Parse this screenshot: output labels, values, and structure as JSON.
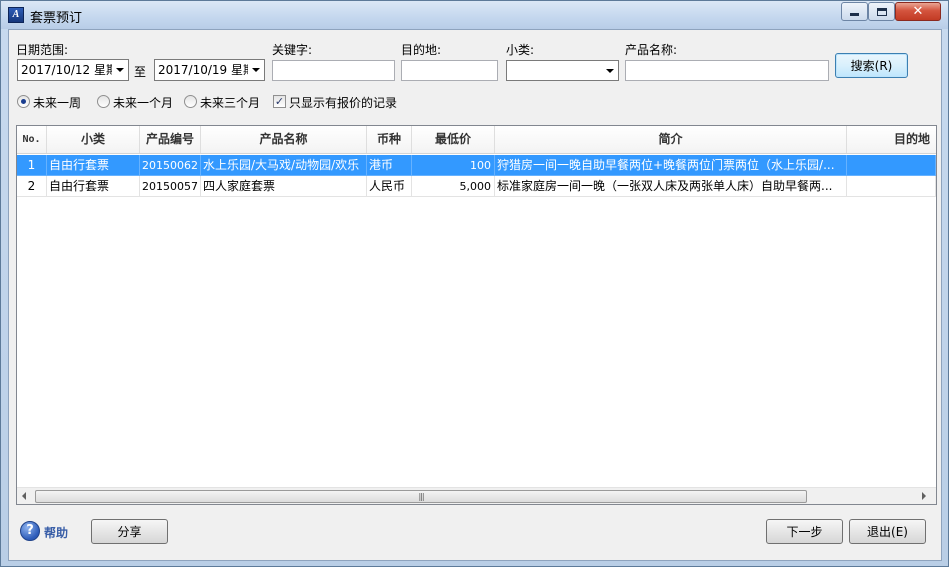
{
  "window": {
    "title": "套票预订"
  },
  "filters": {
    "date_range_label": "日期范围:",
    "date_from": "2017/10/12 星期",
    "to_label": "至",
    "date_to": "2017/10/19 星期",
    "keyword_label": "关键字:",
    "keyword_value": "",
    "destination_label": "目的地:",
    "destination_value": "",
    "subcategory_label": "小类:",
    "subcategory_value": "",
    "product_name_label": "产品名称:",
    "product_name_value": "",
    "search_button": "搜索(R)",
    "radio_options": [
      {
        "label": "未来一周",
        "selected": true
      },
      {
        "label": "未来一个月",
        "selected": false
      },
      {
        "label": "未来三个月",
        "selected": false
      }
    ],
    "quoted_only_label": "只显示有报价的记录",
    "quoted_only_checked": true
  },
  "table": {
    "columns": [
      "No.",
      "小类",
      "产品编号",
      "产品名称",
      "币种",
      "最低价",
      "简介",
      "目的地"
    ],
    "rows": [
      {
        "no": "1",
        "subcategory": "自由行套票",
        "code": "20150062",
        "name": "水上乐园/大马戏/动物园/欢乐",
        "currency": "港币",
        "min_price": "100",
        "intro": "狩猎房一间一晚自助早餐两位+晚餐两位门票两位（水上乐园/...",
        "destination": "",
        "selected": true
      },
      {
        "no": "2",
        "subcategory": "自由行套票",
        "code": "20150057",
        "name": "四人家庭套票",
        "currency": "人民币",
        "min_price": "5,000",
        "intro": "标准家庭房一间一晚（一张双人床及两张单人床）自助早餐两...",
        "destination": "",
        "selected": false
      }
    ]
  },
  "footer": {
    "help_label": "帮助",
    "share_button": "分享",
    "next_button": "下一步",
    "exit_button": "退出(E)"
  },
  "colors": {
    "selection": "#3399ff",
    "title_bar": "#c4d7ee",
    "close_button": "#c23b24"
  }
}
